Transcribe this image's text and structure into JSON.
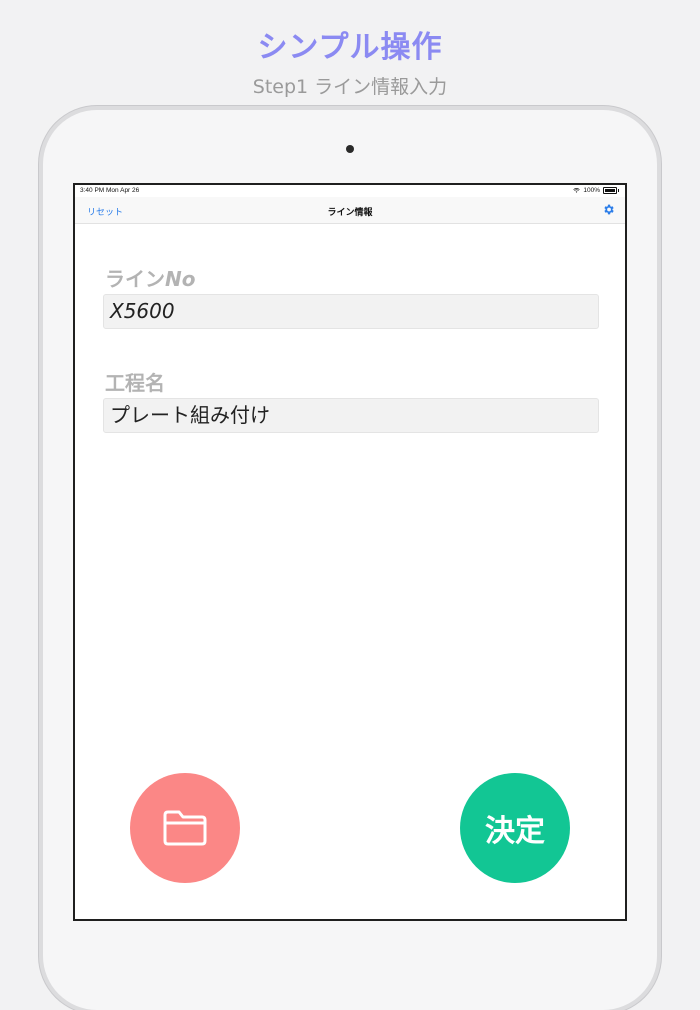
{
  "promo": {
    "title": "シンプル操作",
    "subtitle": "Step1 ライン情報入力"
  },
  "status_bar": {
    "time": "3:40 PM  Mon Apr 26",
    "battery": "100%"
  },
  "nav": {
    "reset_label": "リセット",
    "title": "ライン情報",
    "settings_icon": "gear-icon"
  },
  "form": {
    "line_no_label_jp": "ライン",
    "line_no_label_latin": "No",
    "line_no_value": "X5600",
    "process_label": "工程名",
    "process_value": "プレート組み付け"
  },
  "actions": {
    "folder_icon": "folder-icon",
    "confirm_label": "決定"
  },
  "colors": {
    "title": "#8b8af2",
    "accent_link": "#2b7de9",
    "folder_button": "#fb8786",
    "confirm_button": "#12c694"
  }
}
